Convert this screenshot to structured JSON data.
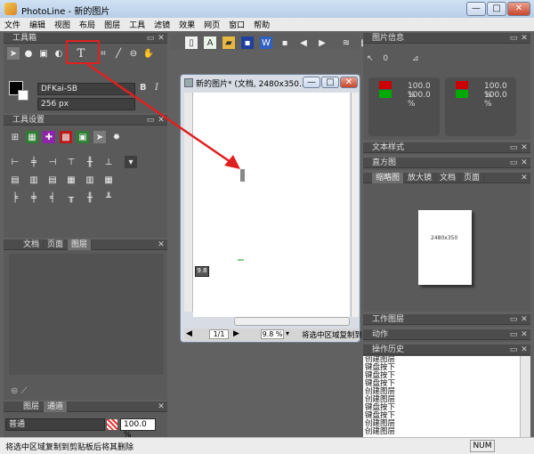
{
  "app": {
    "title": "PhotoLine - 新的图片"
  },
  "window_buttons": {
    "minimize": "—",
    "maximize": "□",
    "close": "✕"
  },
  "menu": [
    "文件",
    "编辑",
    "视图",
    "布局",
    "图层",
    "工具",
    "滤镜",
    "效果",
    "网页",
    "窗口",
    "帮助"
  ],
  "left": {
    "toolbox_title": "工具箱",
    "font_name": "DFKai-SB",
    "font_size": "256 px",
    "bold": "B",
    "italic": "I",
    "tool_settings_title": "工具设置",
    "doc_tabs": [
      "文档",
      "页面",
      "图层"
    ],
    "layer_tabs": [
      "图层",
      "通道"
    ],
    "blend_mode": "普通",
    "opacity": "100.0 %"
  },
  "document": {
    "title": "新的图片* (文档, 2480x350...",
    "page_value": "1/1",
    "zoom": "9.8 %",
    "hint": "将选中区域复制到",
    "tooltip": "9.8"
  },
  "right": {
    "image_info_title": "图片信息",
    "info_zero": "0",
    "info_percent_1a": "100.0 %",
    "info_percent_1b": "100.0 %",
    "info_percent_2a": "100.0 %",
    "info_percent_2b": "100.0 %",
    "text_style_title": "文本样式",
    "histogram_title": "直方图",
    "nav_tabs": [
      "缩略图",
      "放大镜",
      "文档",
      "页面"
    ],
    "thumb_label": "2480x350",
    "work_layer_title": "工作图层",
    "actions_title": "动作",
    "history_title": "操作历史",
    "history_items": [
      "创建图层",
      "键盘按下",
      "键盘按下",
      "键盘按下",
      "创建图层",
      "创建图层",
      "键盘按下",
      "键盘按下",
      "创建图层",
      "创建图层"
    ]
  },
  "status": {
    "text": "将选中区域复制到剪贴板后将其删除",
    "num": "NUM"
  }
}
